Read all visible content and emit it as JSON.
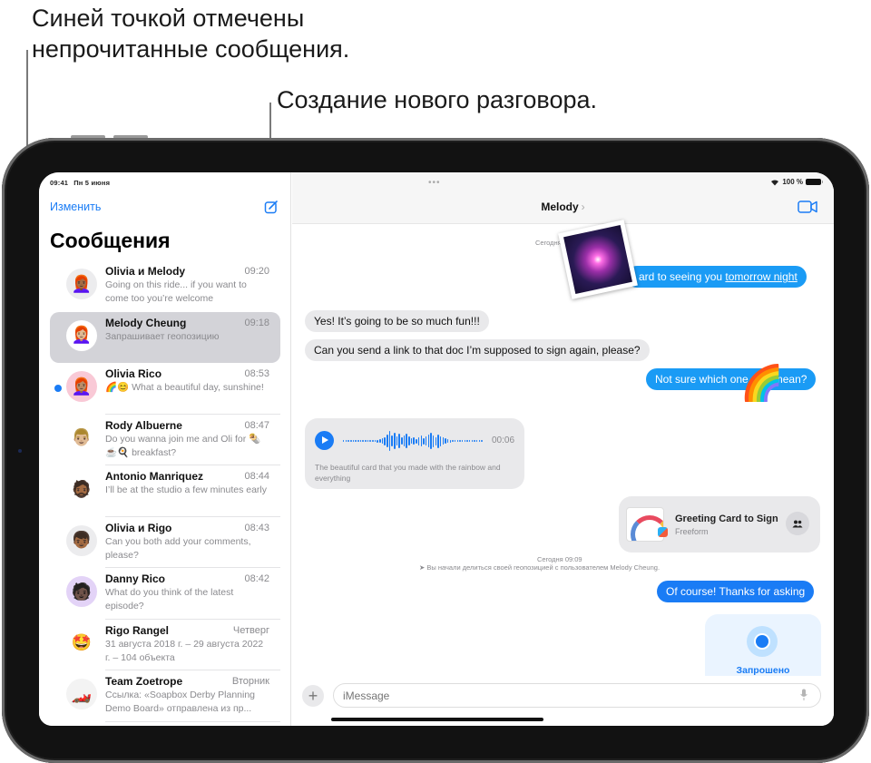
{
  "callouts": {
    "unread": "Синей точкой отмечены непрочитанные сообщения.",
    "compose": "Создание нового разговора."
  },
  "status_bar": {
    "time": "09:41",
    "date": "Пн 5 июня",
    "battery": "100 %"
  },
  "sidebar": {
    "edit_label": "Изменить",
    "title": "Сообщения",
    "conversations": [
      {
        "name": "Olivia и Melody",
        "time": "09:20",
        "preview": "Going on this ride... if you want to come too you’re welcome",
        "avatar": "👩🏾‍🦰",
        "avatar_bg": "#ececee",
        "unread": false,
        "selected": false
      },
      {
        "name": "Melody Cheung",
        "time": "09:18",
        "preview": "Запрашивает геопозицию",
        "avatar": "👩🏼‍🦰",
        "avatar_bg": "#ffffff",
        "unread": false,
        "selected": true
      },
      {
        "name": "Olivia Rico",
        "time": "08:53",
        "preview": "🌈😊 What a beautiful day, sunshine!",
        "avatar": "👩🏽‍🦰",
        "avatar_bg": "#f9c9d6",
        "unread": true,
        "selected": false
      },
      {
        "name": "Rody Albuerne",
        "time": "08:47",
        "preview": "Do you wanna join me and Oli for 🌯☕🍳 breakfast?",
        "avatar": "👨🏼",
        "avatar_bg": "#ffffff",
        "unread": false,
        "selected": false
      },
      {
        "name": "Antonio Manriquez",
        "time": "08:44",
        "preview": "I’ll be at the studio a few minutes early",
        "avatar": "🧔🏾",
        "avatar_bg": "#ffffff",
        "unread": false,
        "selected": false
      },
      {
        "name": "Olivia и Rigo",
        "time": "08:43",
        "preview": "Can you both add your comments, please?",
        "avatar": "👦🏾",
        "avatar_bg": "#ececee",
        "unread": false,
        "selected": false
      },
      {
        "name": "Danny Rico",
        "time": "08:42",
        "preview": "What do you think of the latest episode?",
        "avatar": "🧑🏿",
        "avatar_bg": "#e3d3f7",
        "unread": false,
        "selected": false
      },
      {
        "name": "Rigo Rangel",
        "time": "Четверг",
        "preview": "31 августа 2018 г. – 29 августа 2022 г. – 104 объекта",
        "avatar": "🤩",
        "avatar_bg": "#ffffff",
        "unread": false,
        "selected": false
      },
      {
        "name": "Team Zoetrope",
        "time": "Вторник",
        "preview": "Ссылка: «Soapbox Derby Planning Demo Board» отправлена из пр...",
        "avatar": "🏎️",
        "avatar_bg": "#f3f3f3",
        "unread": false,
        "selected": false
      }
    ]
  },
  "chat": {
    "contact_name": "Melody",
    "messages": {
      "ts1": "Сегодня",
      "out1": "…ard to seeing you tomorrow night",
      "out1_visible": "ard to seeing you ",
      "out1_link": "tomorrow night",
      "in1": "Yes! It’s going to be so much fun!!!",
      "in2": "Can you send a link to that doc I’m supposed to sign again, please?",
      "out2a": "Not sure which one",
      "out2b": "mean?",
      "rainbow": "🌈",
      "audio_duration": "00:06",
      "audio_caption": "The beautiful card that you made with the rainbow and everything",
      "card_title": "Greeting Card to Sign",
      "card_app": "Freeform",
      "ts2": "Сегодня 09:09",
      "location_notice": "Вы начали делиться своей геопозицией с пользователем Melody Cheung.",
      "out3": "Of course! Thanks for asking",
      "location_status": "Запрошено"
    },
    "composer": {
      "placeholder": "iMessage",
      "plus": "+"
    }
  },
  "colors": {
    "accent": "#1a7cf5",
    "bubble_out": "#1a9bf5",
    "bubble_in": "#e9e9eb",
    "unread_dot": "#1a7cf5"
  }
}
